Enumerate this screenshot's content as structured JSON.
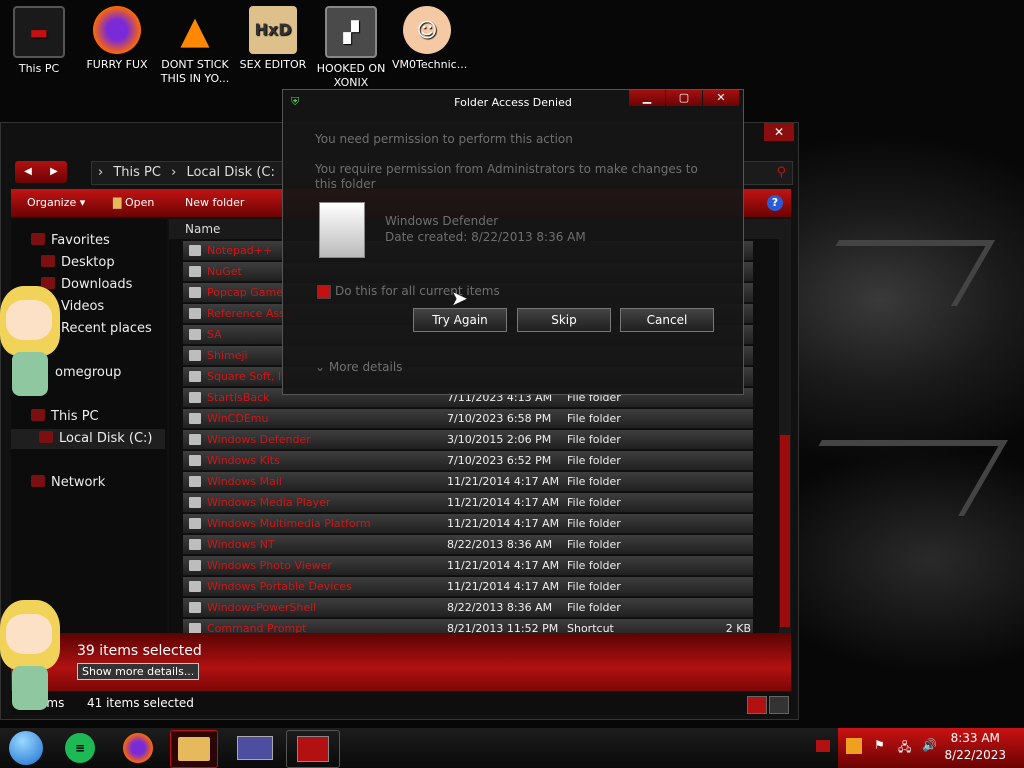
{
  "desktop": {
    "icons": [
      {
        "label": "This PC",
        "color": "#1a1a1a"
      },
      {
        "label": "FURRY FUX",
        "color": "#ff6a00"
      },
      {
        "label": "DONT STICK THIS IN YO...",
        "color": "#ff8800"
      },
      {
        "label": "SEX EDITOR",
        "color": "#ddc08a"
      },
      {
        "label": "HOOKED ON XONIX",
        "color": "#4a4a4a"
      },
      {
        "label": "VM0Technic...",
        "color": "#f4c9a4"
      }
    ]
  },
  "explorer": {
    "close_glyph": "✕",
    "address": {
      "part1": "This PC",
      "part2": "Local Disk (C:",
      "sep": "›"
    },
    "toolbar": {
      "organize": "Organize ▾",
      "open": "Open",
      "new_folder": "New folder",
      "help": "?"
    },
    "nav": {
      "favorites": "Favorites",
      "desktop": "Desktop",
      "downloads": "Downloads",
      "videos": "Videos",
      "recent": "Recent places",
      "homegroup": "omegroup",
      "thispc": "This PC",
      "localdisk": "Local Disk (C:)",
      "network": "Network"
    },
    "columns": {
      "name": "Name"
    },
    "rows": [
      {
        "name": "Notepad++",
        "date": "",
        "type": "",
        "size": ""
      },
      {
        "name": "NuGet",
        "date": "",
        "type": "",
        "size": ""
      },
      {
        "name": "Popcap Game",
        "date": "",
        "type": "",
        "size": ""
      },
      {
        "name": "Reference Asse",
        "date": "",
        "type": "",
        "size": ""
      },
      {
        "name": "SA",
        "date": "",
        "type": "",
        "size": ""
      },
      {
        "name": "Shimeji",
        "date": "",
        "type": "",
        "size": ""
      },
      {
        "name": "Square Soft, Inc",
        "date": "",
        "type": "",
        "size": ""
      },
      {
        "name": "StartIsBack",
        "date": "7/11/2023 4:13 AM",
        "type": "File folder",
        "size": ""
      },
      {
        "name": "WinCDEmu",
        "date": "7/10/2023 6:58 PM",
        "type": "File folder",
        "size": ""
      },
      {
        "name": "Windows Defender",
        "date": "3/10/2015 2:06 PM",
        "type": "File folder",
        "size": ""
      },
      {
        "name": "Windows Kits",
        "date": "7/10/2023 6:52 PM",
        "type": "File folder",
        "size": ""
      },
      {
        "name": "Windows Mail",
        "date": "11/21/2014 4:17 AM",
        "type": "File folder",
        "size": ""
      },
      {
        "name": "Windows Media Player",
        "date": "11/21/2014 4:17 AM",
        "type": "File folder",
        "size": ""
      },
      {
        "name": "Windows Multimedia Platform",
        "date": "11/21/2014 4:17 AM",
        "type": "File folder",
        "size": ""
      },
      {
        "name": "Windows NT",
        "date": "8/22/2013 8:36 AM",
        "type": "File folder",
        "size": ""
      },
      {
        "name": "Windows Photo Viewer",
        "date": "11/21/2014 4:17 AM",
        "type": "File folder",
        "size": ""
      },
      {
        "name": "Windows Portable Devices",
        "date": "11/21/2014 4:17 AM",
        "type": "File folder",
        "size": ""
      },
      {
        "name": "WindowsPowerShell",
        "date": "8/22/2013 8:36 AM",
        "type": "File folder",
        "size": ""
      },
      {
        "name": "Command Prompt",
        "date": "8/21/2013 11:52 PM",
        "type": "Shortcut",
        "size": "2 KB"
      }
    ],
    "details": {
      "selected": "39 items selected",
      "more_button": "Show more details..."
    },
    "status": {
      "items": "ems",
      "selected": "41 items selected"
    }
  },
  "dialog": {
    "title": "Folder Access Denied",
    "btns": {
      "min": "▁",
      "max": "▢",
      "close": "✕"
    },
    "line1": "You need permission to perform this action",
    "line2": "You require permission from Administrators to make changes to this folder",
    "file_name": "Windows Defender",
    "file_date": "Date created: 8/22/2013 8:36 AM",
    "checkbox": "Do this for all current items",
    "try_again": "Try Again",
    "skip": "Skip",
    "cancel": "Cancel",
    "more_details": "More details"
  },
  "taskbar": {
    "time": "8:33 AM",
    "date": "8/22/2023"
  },
  "colors": {
    "accent": "#c31111",
    "dark": "#0a0a0a"
  }
}
